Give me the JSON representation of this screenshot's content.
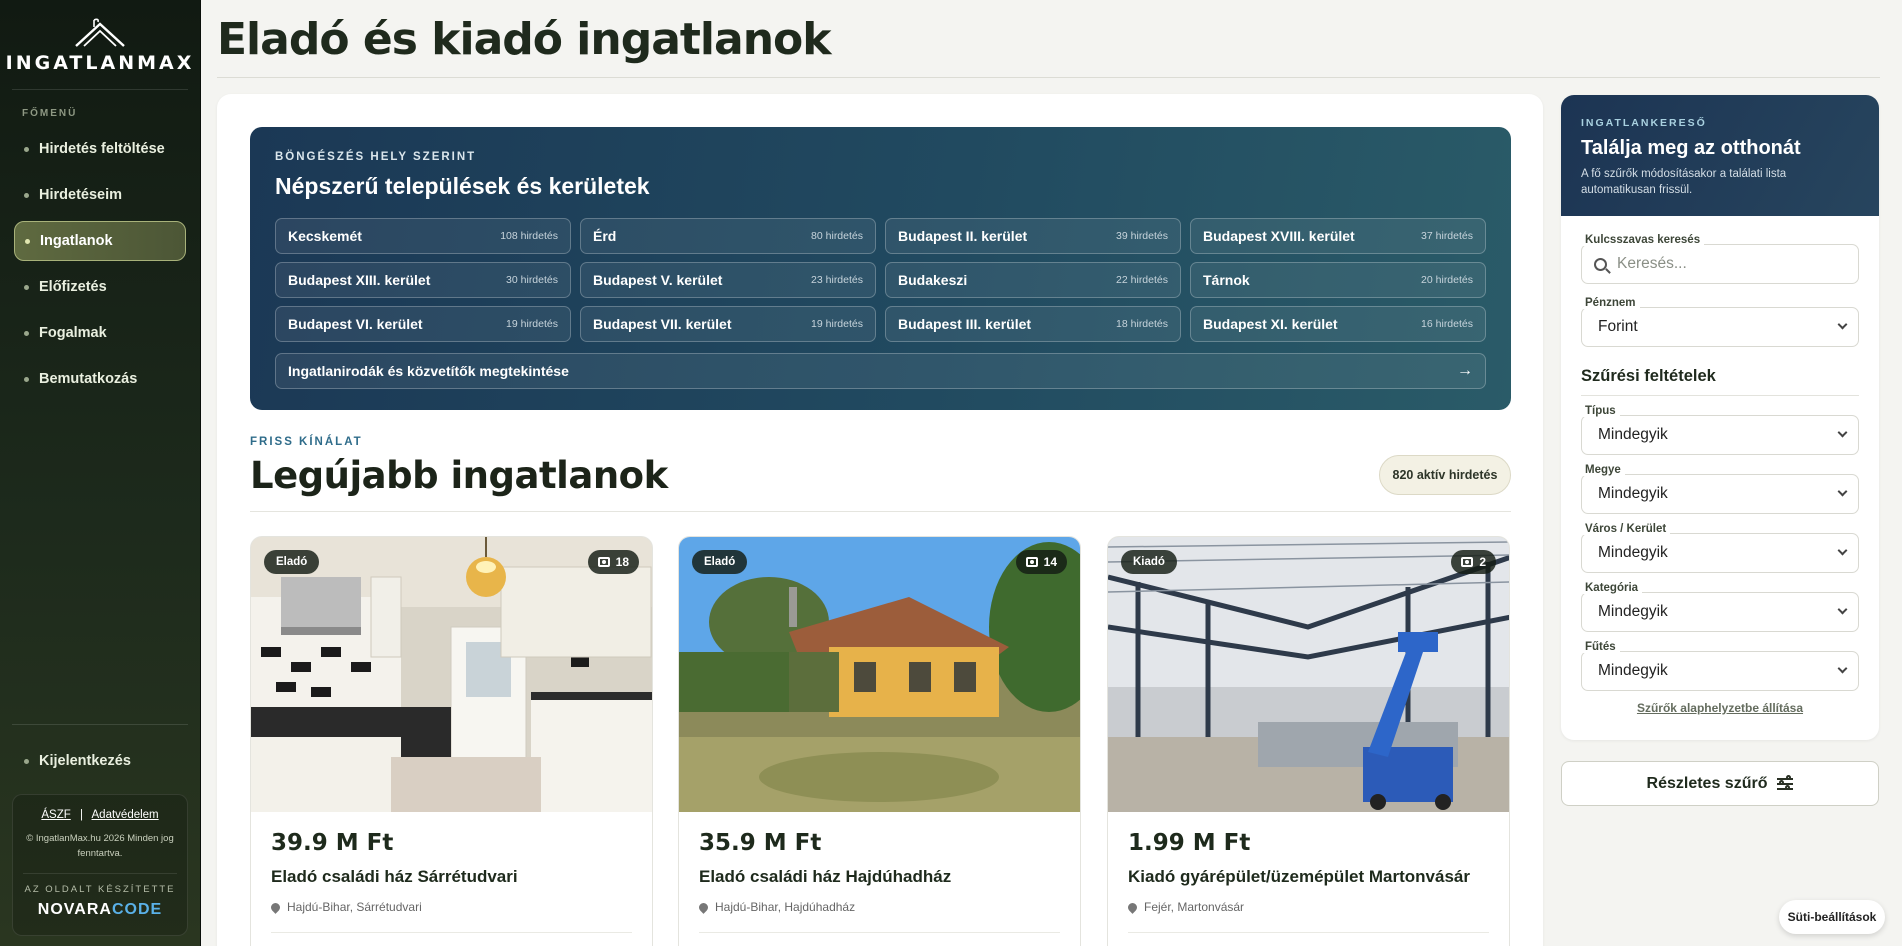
{
  "sidebar": {
    "logo": "INGATLANMAX",
    "section_label": "FŐMENÜ",
    "items": [
      {
        "label": "Hirdetés feltöltése"
      },
      {
        "label": "Hirdetéseim"
      },
      {
        "label": "Ingatlanok",
        "active": true
      },
      {
        "label": "Előfizetés"
      },
      {
        "label": "Fogalmak"
      },
      {
        "label": "Bemutatkozás"
      }
    ],
    "logout": "Kijelentkezés",
    "footer": {
      "aszf": "ÁSZF",
      "separator": "|",
      "privacy": "Adatvédelem",
      "copyright": "© IngatlanMax.hu 2026 Minden jog fenntartva.",
      "made_by": "AZ OLDALT KÉSZÍTETTE",
      "brand_part1": "NOVARA",
      "brand_part2": "CODE"
    }
  },
  "header": {
    "title": "Eladó és kiadó ingatlanok"
  },
  "browse": {
    "kicker": "BÖNGÉSZÉS HELY SZERINT",
    "title": "Népszerű települések és kerületek",
    "locations": [
      {
        "name": "Kecskemét",
        "count": "108 hirdetés"
      },
      {
        "name": "Érd",
        "count": "80 hirdetés"
      },
      {
        "name": "Budapest II. kerület",
        "count": "39 hirdetés"
      },
      {
        "name": "Budapest XVIII. kerület",
        "count": "37 hirdetés"
      },
      {
        "name": "Budapest XIII. kerület",
        "count": "30 hirdetés"
      },
      {
        "name": "Budapest V. kerület",
        "count": "23 hirdetés"
      },
      {
        "name": "Budakeszi",
        "count": "22 hirdetés"
      },
      {
        "name": "Tárnok",
        "count": "20 hirdetés"
      },
      {
        "name": "Budapest VI. kerület",
        "count": "19 hirdetés"
      },
      {
        "name": "Budapest VII. kerület",
        "count": "19 hirdetés"
      },
      {
        "name": "Budapest III. kerület",
        "count": "18 hirdetés"
      },
      {
        "name": "Budapest XI. kerület",
        "count": "16 hirdetés"
      }
    ],
    "agencies_link": "Ingatlanirodák és közvetítők megtekintése",
    "arrow": "→"
  },
  "latest": {
    "kicker": "FRISS KÍNÁLAT",
    "title": "Legújabb ingatlanok",
    "active_count": "820 aktív hirdetés",
    "listings": [
      {
        "badge": "Eladó",
        "photos": "18",
        "price": "39.9 M Ft",
        "title": "Eladó családi ház Sárrétudvari",
        "location": "Hajdú-Bihar, Sárrétudvari"
      },
      {
        "badge": "Eladó",
        "photos": "14",
        "price": "35.9 M Ft",
        "title": "Eladó családi ház Hajdúhadház",
        "location": "Hajdú-Bihar, Hajdúhadház"
      },
      {
        "badge": "Kiadó",
        "photos": "2",
        "price": "1.99 M Ft",
        "title": "Kiadó gyárépület/üzemépület Martonvásár",
        "location": "Fejér, Martonvásár"
      }
    ]
  },
  "search": {
    "kicker": "INGATLANKERESŐ",
    "title": "Találja meg az otthonát",
    "subtitle": "A fő szűrők módosításakor a találati lista automatikusan frissül.",
    "keyword_label": "Kulcsszavas keresés",
    "keyword_placeholder": "Keresés...",
    "currency_label": "Pénznem",
    "currency_value": "Forint",
    "filters_title": "Szűrési feltételek",
    "filters": [
      {
        "label": "Típus",
        "value": "Mindegyik"
      },
      {
        "label": "Megye",
        "value": "Mindegyik"
      },
      {
        "label": "Város / Kerület",
        "value": "Mindegyik"
      },
      {
        "label": "Kategória",
        "value": "Mindegyik"
      },
      {
        "label": "Fűtés",
        "value": "Mindegyik"
      }
    ],
    "reset": "Szűrők alaphelyzetbe állítása",
    "detailed_button": "Részletes szűrő"
  },
  "cookie_button": "Süti-beállítások"
}
